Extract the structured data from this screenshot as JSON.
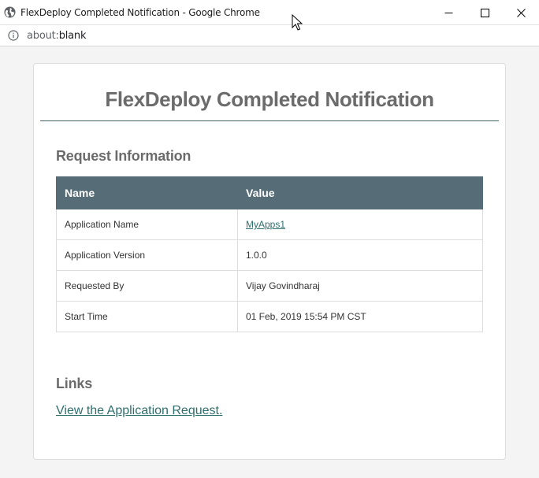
{
  "window": {
    "title": "FlexDeploy Completed Notification - Google Chrome",
    "url_scheme": "about:",
    "url_host": "blank"
  },
  "email": {
    "heading": "FlexDeploy Completed Notification",
    "request_section_title": "Request Information",
    "table": {
      "headers": [
        "Name",
        "Value"
      ],
      "rows": [
        {
          "name": "Application Name",
          "value": "MyApps1",
          "is_link": true
        },
        {
          "name": "Application Version",
          "value": "1.0.0"
        },
        {
          "name": "Requested By",
          "value": "Vijay Govindharaj"
        },
        {
          "name": "Start Time",
          "value": "01 Feb, 2019 15:54 PM CST"
        }
      ]
    },
    "links_section_title": "Links",
    "view_request_link": "View the Application Request."
  },
  "colors": {
    "table_header_bg": "#566d77",
    "link": "#2e6f6d",
    "heading_text": "#6b6b6b",
    "heading_rule": "#3f5f63"
  },
  "icons": {
    "tab_icon": "globe-icon",
    "address_icon": "info-icon",
    "minimize": "minimize-icon",
    "maximize": "maximize-icon",
    "close": "close-icon",
    "cursor": "mouse-pointer-icon"
  }
}
